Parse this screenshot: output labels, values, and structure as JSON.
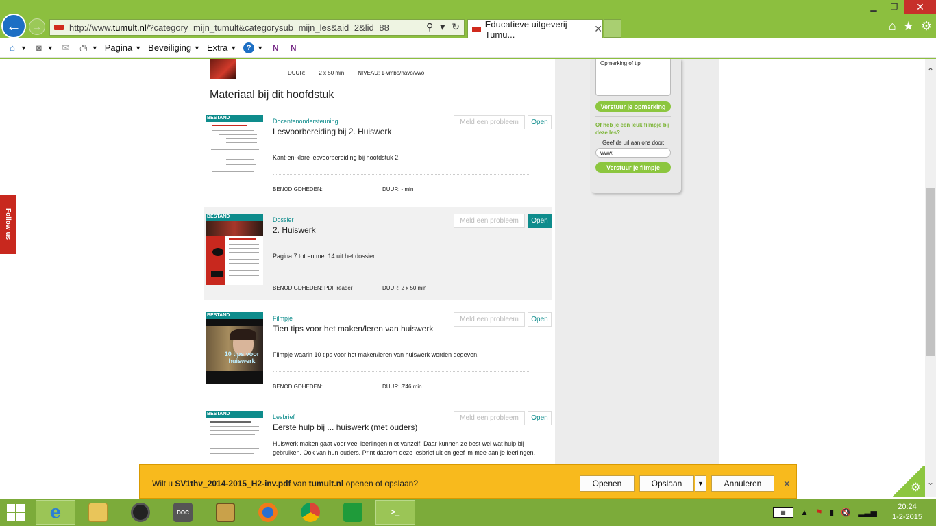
{
  "browser": {
    "url_prefix": "http://www.",
    "url_host": "tumult.nl",
    "url_rest": "/?category=mijn_tumult&categorysub=mijn_les&aid=2&lid=88",
    "tab_title": "Educatieve uitgeverij Tumu...",
    "commands": [
      "Pagina",
      "Beveiliging",
      "Extra"
    ]
  },
  "top_item": {
    "duration": "DUUR:",
    "duration_value": "2 x 50 min",
    "level": "NIVEAU: 1-vmbo/havo/vwo"
  },
  "section_title": "Materiaal bij dit hoofdstuk",
  "items": [
    {
      "type": "Docentenondersteuning",
      "title": "Lesvoorbereiding bij 2. Huiswerk",
      "desc": "Kant-en-klare lesvoorbereiding bij hoofdstuk 2.",
      "req": "BENODIGDHEDEN:",
      "dur": "DUUR: - min",
      "badge": "BESTAND",
      "report": "Meld een probleem",
      "open": "Open"
    },
    {
      "type": "Dossier",
      "title": "2. Huiswerk",
      "desc": "Pagina 7 tot en met 14 uit het dossier.",
      "req": "BENODIGDHEDEN: PDF reader",
      "dur": "DUUR: 2 x 50 min",
      "badge": "BESTAND",
      "report": "Meld een probleem",
      "open": "Open"
    },
    {
      "type": "Filmpje",
      "title": "Tien tips voor het maken/leren van huiswerk",
      "desc": "Filmpje waarin 10 tips voor het maken/leren van huiswerk worden gegeven.",
      "req": "BENODIGDHEDEN:",
      "dur": "DUUR: 3'46 min",
      "badge": "BESTAND",
      "report": "Meld een probleem",
      "open": "Open",
      "thumb_caption": "10 tips voor huiswerk"
    },
    {
      "type": "Lesbrief",
      "title": "Eerste hulp bij ... huiswerk (met ouders)",
      "desc": "Huiswerk maken gaat voor veel leerlingen niet vanzelf. Daar kunnen ze best wel wat hulp bij gebruiken. Ook van hun ouders. Print daarom deze lesbrief uit en geef 'm mee aan je leerlingen.",
      "badge": "BESTAND",
      "report": "Meld een probleem",
      "open": "Open"
    }
  ],
  "sidebar": {
    "textarea_placeholder": "Opmerking of tip",
    "send_remark": "Verstuur je opmerking",
    "video_question": "Of heb je een leuk filmpje bij deze les?",
    "url_label": "Geef de url aan ons door:",
    "url_value": "www.",
    "send_video": "Verstuur je filmpje"
  },
  "follow_us": "Follow us",
  "download": {
    "prefix": "Wilt u",
    "filename": "SV1thv_2014-2015_H2-inv.pdf",
    "middle": "van",
    "source": "tumult.nl",
    "suffix": "openen of opslaan?",
    "open": "Openen",
    "save": "Opslaan",
    "cancel": "Annuleren"
  },
  "clock": {
    "time": "20:24",
    "date": "1-2-2015"
  },
  "taskbar": {
    "doc_label": "DOC"
  },
  "colors": {
    "accent": "#0e8c8c",
    "green": "#8cc63f",
    "chrome": "#8cbf3f",
    "notify": "#f8ba1d"
  }
}
